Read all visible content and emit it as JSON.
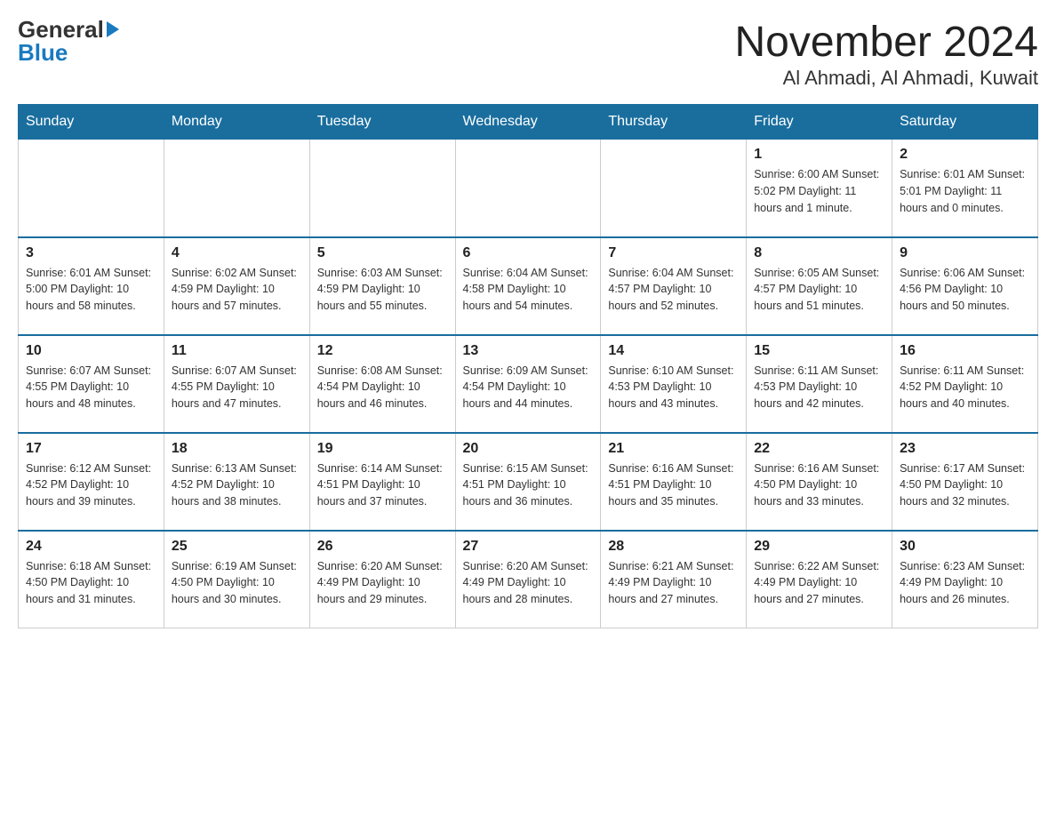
{
  "header": {
    "logo_line1": "General",
    "logo_line2": "Blue",
    "month_title": "November 2024",
    "location": "Al Ahmadi, Al Ahmadi, Kuwait"
  },
  "weekdays": [
    "Sunday",
    "Monday",
    "Tuesday",
    "Wednesday",
    "Thursday",
    "Friday",
    "Saturday"
  ],
  "weeks": [
    [
      {
        "day": "",
        "info": ""
      },
      {
        "day": "",
        "info": ""
      },
      {
        "day": "",
        "info": ""
      },
      {
        "day": "",
        "info": ""
      },
      {
        "day": "",
        "info": ""
      },
      {
        "day": "1",
        "info": "Sunrise: 6:00 AM\nSunset: 5:02 PM\nDaylight: 11 hours and 1 minute."
      },
      {
        "day": "2",
        "info": "Sunrise: 6:01 AM\nSunset: 5:01 PM\nDaylight: 11 hours and 0 minutes."
      }
    ],
    [
      {
        "day": "3",
        "info": "Sunrise: 6:01 AM\nSunset: 5:00 PM\nDaylight: 10 hours and 58 minutes."
      },
      {
        "day": "4",
        "info": "Sunrise: 6:02 AM\nSunset: 4:59 PM\nDaylight: 10 hours and 57 minutes."
      },
      {
        "day": "5",
        "info": "Sunrise: 6:03 AM\nSunset: 4:59 PM\nDaylight: 10 hours and 55 minutes."
      },
      {
        "day": "6",
        "info": "Sunrise: 6:04 AM\nSunset: 4:58 PM\nDaylight: 10 hours and 54 minutes."
      },
      {
        "day": "7",
        "info": "Sunrise: 6:04 AM\nSunset: 4:57 PM\nDaylight: 10 hours and 52 minutes."
      },
      {
        "day": "8",
        "info": "Sunrise: 6:05 AM\nSunset: 4:57 PM\nDaylight: 10 hours and 51 minutes."
      },
      {
        "day": "9",
        "info": "Sunrise: 6:06 AM\nSunset: 4:56 PM\nDaylight: 10 hours and 50 minutes."
      }
    ],
    [
      {
        "day": "10",
        "info": "Sunrise: 6:07 AM\nSunset: 4:55 PM\nDaylight: 10 hours and 48 minutes."
      },
      {
        "day": "11",
        "info": "Sunrise: 6:07 AM\nSunset: 4:55 PM\nDaylight: 10 hours and 47 minutes."
      },
      {
        "day": "12",
        "info": "Sunrise: 6:08 AM\nSunset: 4:54 PM\nDaylight: 10 hours and 46 minutes."
      },
      {
        "day": "13",
        "info": "Sunrise: 6:09 AM\nSunset: 4:54 PM\nDaylight: 10 hours and 44 minutes."
      },
      {
        "day": "14",
        "info": "Sunrise: 6:10 AM\nSunset: 4:53 PM\nDaylight: 10 hours and 43 minutes."
      },
      {
        "day": "15",
        "info": "Sunrise: 6:11 AM\nSunset: 4:53 PM\nDaylight: 10 hours and 42 minutes."
      },
      {
        "day": "16",
        "info": "Sunrise: 6:11 AM\nSunset: 4:52 PM\nDaylight: 10 hours and 40 minutes."
      }
    ],
    [
      {
        "day": "17",
        "info": "Sunrise: 6:12 AM\nSunset: 4:52 PM\nDaylight: 10 hours and 39 minutes."
      },
      {
        "day": "18",
        "info": "Sunrise: 6:13 AM\nSunset: 4:52 PM\nDaylight: 10 hours and 38 minutes."
      },
      {
        "day": "19",
        "info": "Sunrise: 6:14 AM\nSunset: 4:51 PM\nDaylight: 10 hours and 37 minutes."
      },
      {
        "day": "20",
        "info": "Sunrise: 6:15 AM\nSunset: 4:51 PM\nDaylight: 10 hours and 36 minutes."
      },
      {
        "day": "21",
        "info": "Sunrise: 6:16 AM\nSunset: 4:51 PM\nDaylight: 10 hours and 35 minutes."
      },
      {
        "day": "22",
        "info": "Sunrise: 6:16 AM\nSunset: 4:50 PM\nDaylight: 10 hours and 33 minutes."
      },
      {
        "day": "23",
        "info": "Sunrise: 6:17 AM\nSunset: 4:50 PM\nDaylight: 10 hours and 32 minutes."
      }
    ],
    [
      {
        "day": "24",
        "info": "Sunrise: 6:18 AM\nSunset: 4:50 PM\nDaylight: 10 hours and 31 minutes."
      },
      {
        "day": "25",
        "info": "Sunrise: 6:19 AM\nSunset: 4:50 PM\nDaylight: 10 hours and 30 minutes."
      },
      {
        "day": "26",
        "info": "Sunrise: 6:20 AM\nSunset: 4:49 PM\nDaylight: 10 hours and 29 minutes."
      },
      {
        "day": "27",
        "info": "Sunrise: 6:20 AM\nSunset: 4:49 PM\nDaylight: 10 hours and 28 minutes."
      },
      {
        "day": "28",
        "info": "Sunrise: 6:21 AM\nSunset: 4:49 PM\nDaylight: 10 hours and 27 minutes."
      },
      {
        "day": "29",
        "info": "Sunrise: 6:22 AM\nSunset: 4:49 PM\nDaylight: 10 hours and 27 minutes."
      },
      {
        "day": "30",
        "info": "Sunrise: 6:23 AM\nSunset: 4:49 PM\nDaylight: 10 hours and 26 minutes."
      }
    ]
  ]
}
